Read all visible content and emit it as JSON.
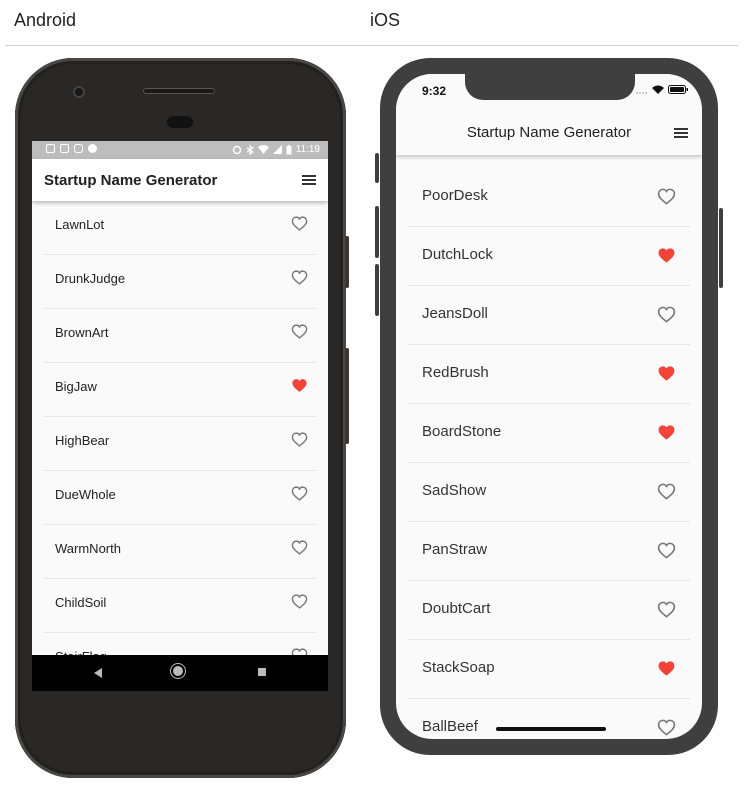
{
  "labels": {
    "android": "Android",
    "ios": "iOS"
  },
  "colors": {
    "favorite": "#f44336",
    "icon": "#777777"
  },
  "android": {
    "status_time": "11:19",
    "app_title": "Startup Name Generator",
    "items": [
      {
        "name": "LawnLot",
        "favorite": false
      },
      {
        "name": "DrunkJudge",
        "favorite": false
      },
      {
        "name": "BrownArt",
        "favorite": false
      },
      {
        "name": "BigJaw",
        "favorite": true
      },
      {
        "name": "HighBear",
        "favorite": false
      },
      {
        "name": "DueWhole",
        "favorite": false
      },
      {
        "name": "WarmNorth",
        "favorite": false
      },
      {
        "name": "ChildSoil",
        "favorite": false
      },
      {
        "name": "StairFlag",
        "favorite": false
      }
    ]
  },
  "ios": {
    "status_time": "9:32",
    "app_title": "Startup Name Generator",
    "items": [
      {
        "name": "PoorDesk",
        "favorite": false
      },
      {
        "name": "DutchLock",
        "favorite": true
      },
      {
        "name": "JeansDoll",
        "favorite": false
      },
      {
        "name": "RedBrush",
        "favorite": true
      },
      {
        "name": "BoardStone",
        "favorite": true
      },
      {
        "name": "SadShow",
        "favorite": false
      },
      {
        "name": "PanStraw",
        "favorite": false
      },
      {
        "name": "DoubtCart",
        "favorite": false
      },
      {
        "name": "StackSoap",
        "favorite": true
      },
      {
        "name": "BallBeef",
        "favorite": false
      }
    ]
  }
}
